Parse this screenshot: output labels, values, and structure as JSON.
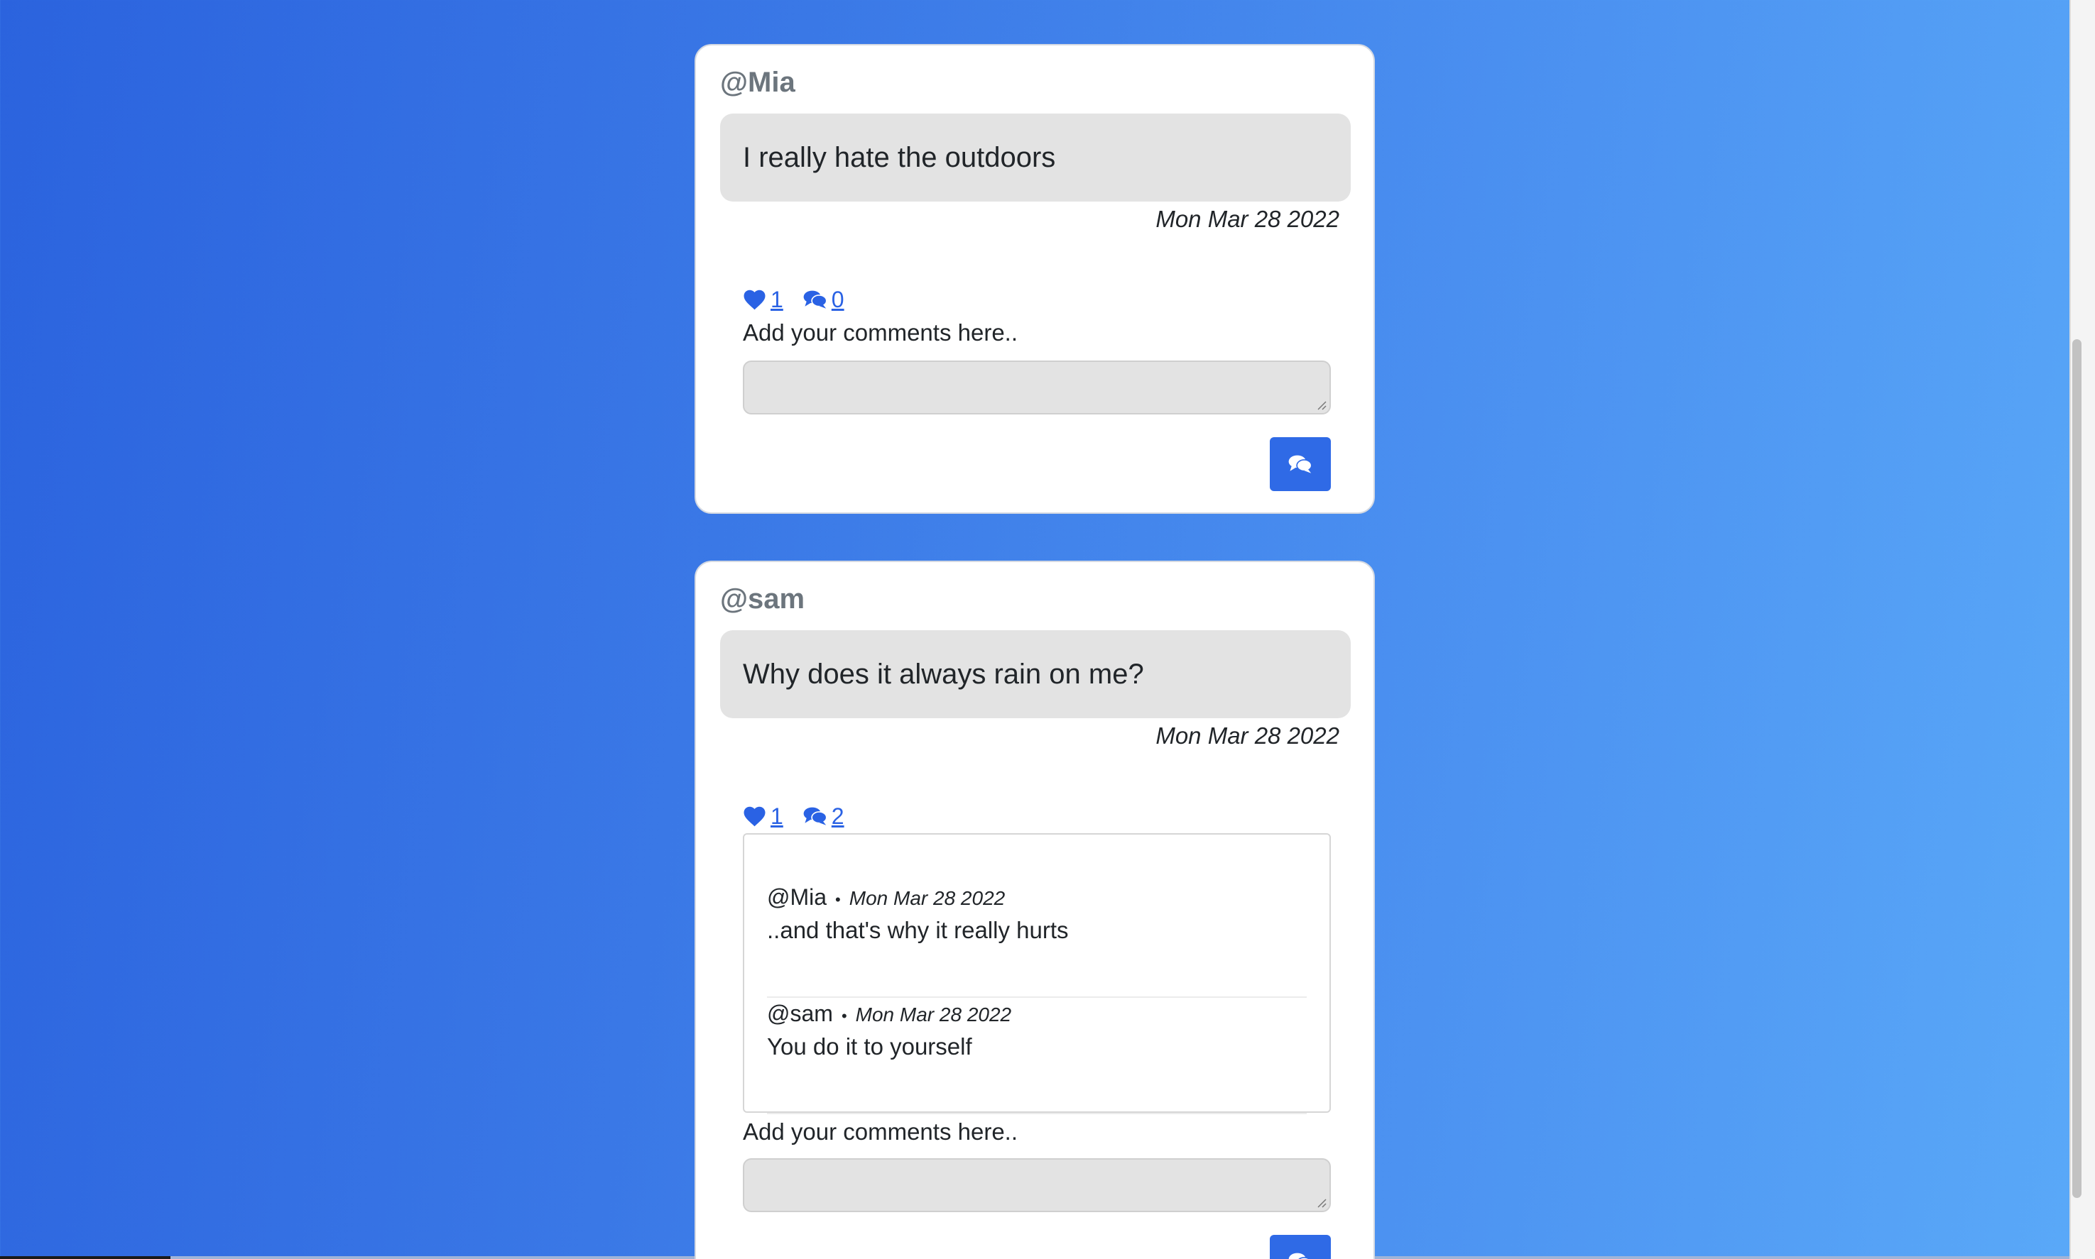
{
  "posts": [
    {
      "author": "@Mia",
      "text": "I really hate the outdoors",
      "date": "Mon Mar 28 2022",
      "likes": "1",
      "comment_count": "0",
      "comment_label": "Add your comments here..",
      "comments": []
    },
    {
      "author": "@sam",
      "text": "Why does it always rain on me?",
      "date": "Mon Mar 28 2022",
      "likes": "1",
      "comment_count": "2",
      "comment_label": "Add your comments here..",
      "comments": [
        {
          "author": "@Mia",
          "separator": "•",
          "date": "Mon Mar 28 2022",
          "text": "..and that's why it really hurts"
        },
        {
          "author": "@sam",
          "separator": "•",
          "date": "Mon Mar 28 2022",
          "text": "You do it to yourself"
        }
      ]
    }
  ],
  "icons": {
    "like": "heart-icon",
    "comments": "comments-icon",
    "send": "comments-icon"
  },
  "colors": {
    "accent": "#2f6ae6",
    "bubble": "#e3e3e3",
    "handle": "#6c757d",
    "background_start": "#2b63de",
    "background_end": "#5aa9f8"
  }
}
